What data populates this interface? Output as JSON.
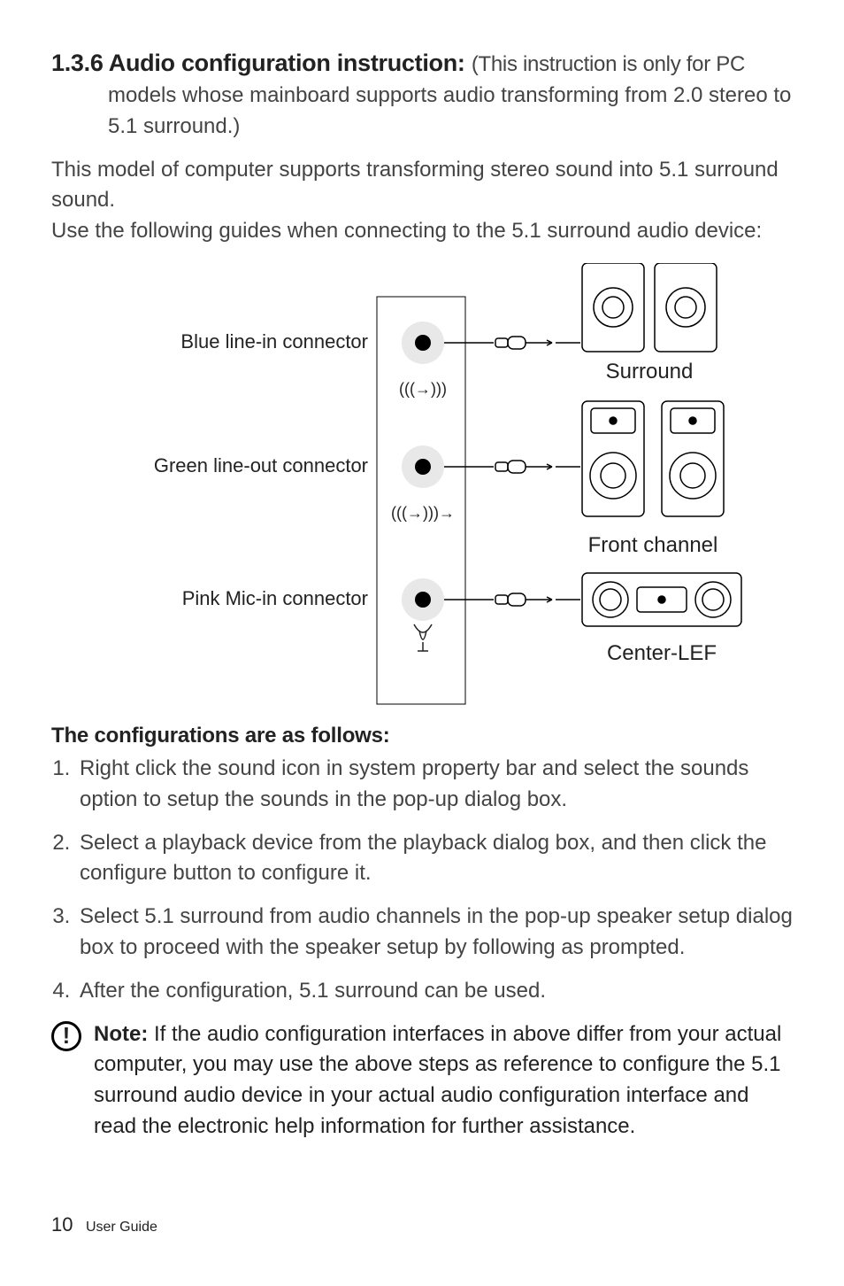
{
  "heading": {
    "number": "1.3.6",
    "title_bold": "Audio configuration instruction:",
    "title_tail": "(This instruction is only for PC",
    "cont1": "models whose mainboard supports audio transforming from 2.0 stereo to",
    "cont2": "5.1 surround.)"
  },
  "para1": "This model of computer supports transforming stereo sound into 5.1 surround sound.",
  "para2": "Use the following guides when connecting to the 5.1 surround audio device:",
  "diagram": {
    "label_blue": "Blue line-in connector",
    "label_green": "Green line-out connector",
    "label_pink": "Pink Mic-in connector",
    "label_surround": "Surround",
    "label_front": "Front channel",
    "label_center": "Center-LEF"
  },
  "sub_heading": "The configurations are as follows:",
  "steps": [
    "Right click the sound icon in system property bar and select the sounds option to setup the sounds in the pop-up dialog box.",
    "Select a playback device from the playback dialog box, and then click the configure button to configure it.",
    "Select 5.1 surround from audio channels in the pop-up speaker setup dialog box to proceed with the speaker setup by following as prompted.",
    "After the configuration, 5.1 surround can be used."
  ],
  "note": {
    "label": "Note:",
    "text": "If the audio configuration interfaces in above differ from your actual computer, you may use the above steps as reference to configure the 5.1 surround audio device in your actual audio configuration interface and read the electronic help information for further assistance."
  },
  "footer": {
    "page_number": "10",
    "doc_title": "User Guide"
  }
}
